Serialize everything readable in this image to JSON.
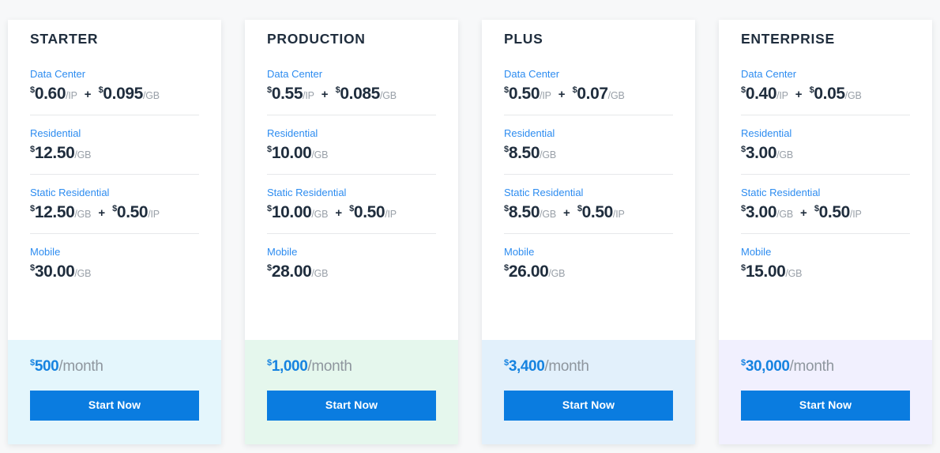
{
  "theme": {
    "page_background": "#f7f8f9",
    "card_background": "#ffffff",
    "title_color": "#1f2d3d",
    "label_color": "#2d8cf0",
    "unit_color": "#99a0a8",
    "monthly_color": "#1683e0",
    "period_color": "#8e969e",
    "button_color": "#0a7ce0",
    "button_text_color": "#ffffff",
    "divider_color": "#e6e8ea"
  },
  "plans": [
    {
      "name": "STARTER",
      "footer_background": "#e4f6fc",
      "features": [
        {
          "label": "Data Center",
          "prices": [
            {
              "currency": "$",
              "amount": "0.60",
              "unit": "/IP"
            },
            {
              "currency": "$",
              "amount": "0.095",
              "unit": "/GB"
            }
          ],
          "separator": "+"
        },
        {
          "label": "Residential",
          "prices": [
            {
              "currency": "$",
              "amount": "12.50",
              "unit": "/GB"
            }
          ],
          "separator": ""
        },
        {
          "label": "Static Residential",
          "prices": [
            {
              "currency": "$",
              "amount": "12.50",
              "unit": "/GB"
            },
            {
              "currency": "$",
              "amount": "0.50",
              "unit": "/IP"
            }
          ],
          "separator": "+"
        },
        {
          "label": "Mobile",
          "prices": [
            {
              "currency": "$",
              "amount": "30.00",
              "unit": "/GB"
            }
          ],
          "separator": ""
        }
      ],
      "monthly": {
        "currency": "$",
        "amount": "500",
        "period": "/month"
      },
      "cta_label": "Start Now"
    },
    {
      "name": "PRODUCTION",
      "footer_background": "#e5f7ed",
      "features": [
        {
          "label": "Data Center",
          "prices": [
            {
              "currency": "$",
              "amount": "0.55",
              "unit": "/IP"
            },
            {
              "currency": "$",
              "amount": "0.085",
              "unit": "/GB"
            }
          ],
          "separator": "+"
        },
        {
          "label": "Residential",
          "prices": [
            {
              "currency": "$",
              "amount": "10.00",
              "unit": "/GB"
            }
          ],
          "separator": ""
        },
        {
          "label": "Static Residential",
          "prices": [
            {
              "currency": "$",
              "amount": "10.00",
              "unit": "/GB"
            },
            {
              "currency": "$",
              "amount": "0.50",
              "unit": "/IP"
            }
          ],
          "separator": "+"
        },
        {
          "label": "Mobile",
          "prices": [
            {
              "currency": "$",
              "amount": "28.00",
              "unit": "/GB"
            }
          ],
          "separator": ""
        }
      ],
      "monthly": {
        "currency": "$",
        "amount": "1,000",
        "period": "/month"
      },
      "cta_label": "Start Now"
    },
    {
      "name": "PLUS",
      "footer_background": "#e2f0fb",
      "features": [
        {
          "label": "Data Center",
          "prices": [
            {
              "currency": "$",
              "amount": "0.50",
              "unit": "/IP"
            },
            {
              "currency": "$",
              "amount": "0.07",
              "unit": "/GB"
            }
          ],
          "separator": "+"
        },
        {
          "label": "Residential",
          "prices": [
            {
              "currency": "$",
              "amount": "8.50",
              "unit": "/GB"
            }
          ],
          "separator": ""
        },
        {
          "label": "Static Residential",
          "prices": [
            {
              "currency": "$",
              "amount": "8.50",
              "unit": "/GB"
            },
            {
              "currency": "$",
              "amount": "0.50",
              "unit": "/IP"
            }
          ],
          "separator": "+"
        },
        {
          "label": "Mobile",
          "prices": [
            {
              "currency": "$",
              "amount": "26.00",
              "unit": "/GB"
            }
          ],
          "separator": ""
        }
      ],
      "monthly": {
        "currency": "$",
        "amount": "3,400",
        "period": "/month"
      },
      "cta_label": "Start Now"
    },
    {
      "name": "ENTERPRISE",
      "footer_background": "#f1f0fe",
      "features": [
        {
          "label": "Data Center",
          "prices": [
            {
              "currency": "$",
              "amount": "0.40",
              "unit": "/IP"
            },
            {
              "currency": "$",
              "amount": "0.05",
              "unit": "/GB"
            }
          ],
          "separator": "+"
        },
        {
          "label": "Residential",
          "prices": [
            {
              "currency": "$",
              "amount": "3.00",
              "unit": "/GB"
            }
          ],
          "separator": ""
        },
        {
          "label": "Static Residential",
          "prices": [
            {
              "currency": "$",
              "amount": "3.00",
              "unit": "/GB"
            },
            {
              "currency": "$",
              "amount": "0.50",
              "unit": "/IP"
            }
          ],
          "separator": "+"
        },
        {
          "label": "Mobile",
          "prices": [
            {
              "currency": "$",
              "amount": "15.00",
              "unit": "/GB"
            }
          ],
          "separator": ""
        }
      ],
      "monthly": {
        "currency": "$",
        "amount": "30,000",
        "period": "/month"
      },
      "cta_label": "Start Now"
    }
  ]
}
